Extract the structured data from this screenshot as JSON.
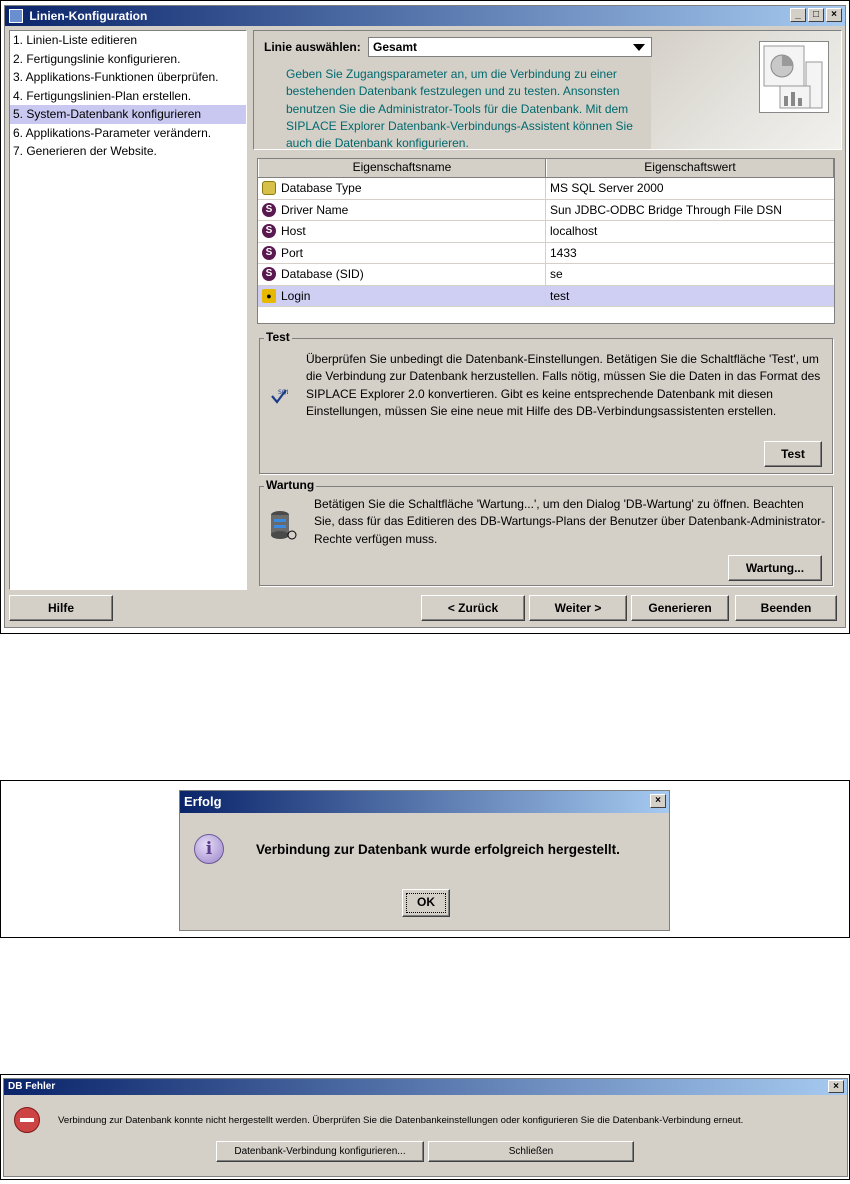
{
  "main_window": {
    "title": "Linien-Konfiguration",
    "title_buttons": {
      "minimize": "_",
      "maximize": "□",
      "close": "×"
    },
    "steps": [
      "1. Linien-Liste editieren",
      "2. Fertigungslinie konfigurieren.",
      "3. Applikations-Funktionen überprüfen.",
      "4. Fertigungslinien-Plan erstellen.",
      "5. System-Datenbank konfigurieren",
      "6. Applikations-Parameter verändern.",
      "7. Generieren der Website."
    ],
    "active_step": 4,
    "line_select": {
      "label": "Linie auswählen:",
      "value": "Gesamt"
    },
    "intro_text": "Geben Sie Zugangsparameter an, um die Verbindung zu einer bestehenden Datenbank festzulegen und zu testen. Ansonsten benutzen Sie die Administrator-Tools für die Datenbank. Mit dem SIPLACE Explorer Datenbank-Verbindungs-Assistent können Sie auch die Datenbank konfigurieren.",
    "table": {
      "headers": [
        "Eigenschaftsname",
        "Eigenschaftswert"
      ],
      "rows": [
        {
          "icon": "database-icon",
          "name": "Database Type",
          "value": "MS SQL Server 2000"
        },
        {
          "icon": "s-icon",
          "name": "Driver Name",
          "value": "Sun JDBC-ODBC Bridge Through File DSN"
        },
        {
          "icon": "s-icon",
          "name": "Host",
          "value": "localhost"
        },
        {
          "icon": "s-icon",
          "name": "Port",
          "value": "1433"
        },
        {
          "icon": "s-icon",
          "name": "Database (SID)",
          "value": "se"
        },
        {
          "icon": "lock-icon",
          "name": "Login",
          "value": "test"
        }
      ],
      "selected_row": 5,
      "icon_glyph": "S"
    },
    "test_group": {
      "label": "Test",
      "text": "Überprüfen Sie unbedingt die Datenbank-Einstellungen. Betätigen Sie die Schaltfläche 'Test', um die Verbindung zur Datenbank herzustellen. Falls nötig, müssen Sie die Daten in das Format des SIPLACE Explorer 2.0 konvertieren. Gibt es keine entsprechende Datenbank mit diesen Einstellungen, müssen Sie eine neue mit Hilfe des DB-Verbindungsassistenten erstellen.",
      "button": "Test"
    },
    "maintenance_group": {
      "label": "Wartung",
      "text": "Betätigen Sie die Schaltfläche 'Wartung...', um den Dialog 'DB-Wartung' zu öffnen. Beachten Sie, dass für das Editieren des DB-Wartungs-Plans der Benutzer über Datenbank-Administrator-Rechte verfügen muss.",
      "button": "Wartung..."
    },
    "footer": {
      "help": "Hilfe",
      "back": "< Zurück",
      "next": "Weiter >",
      "generate": "Generieren",
      "finish": "Beenden"
    }
  },
  "success_dialog": {
    "title": "Erfolg",
    "close": "×",
    "message": "Verbindung zur Datenbank wurde erfolgreich hergestellt.",
    "ok": "OK",
    "info_glyph": "i"
  },
  "error_dialog": {
    "title": "DB Fehler",
    "close": "×",
    "message": "Verbindung zur Datenbank konnte nicht hergestellt werden. Überprüfen Sie die Datenbankeinstellungen oder konfigurieren Sie die Datenbank-Verbindung erneut.",
    "configure": "Datenbank-Verbindung konfigurieren...",
    "close_button": "Schließen"
  }
}
